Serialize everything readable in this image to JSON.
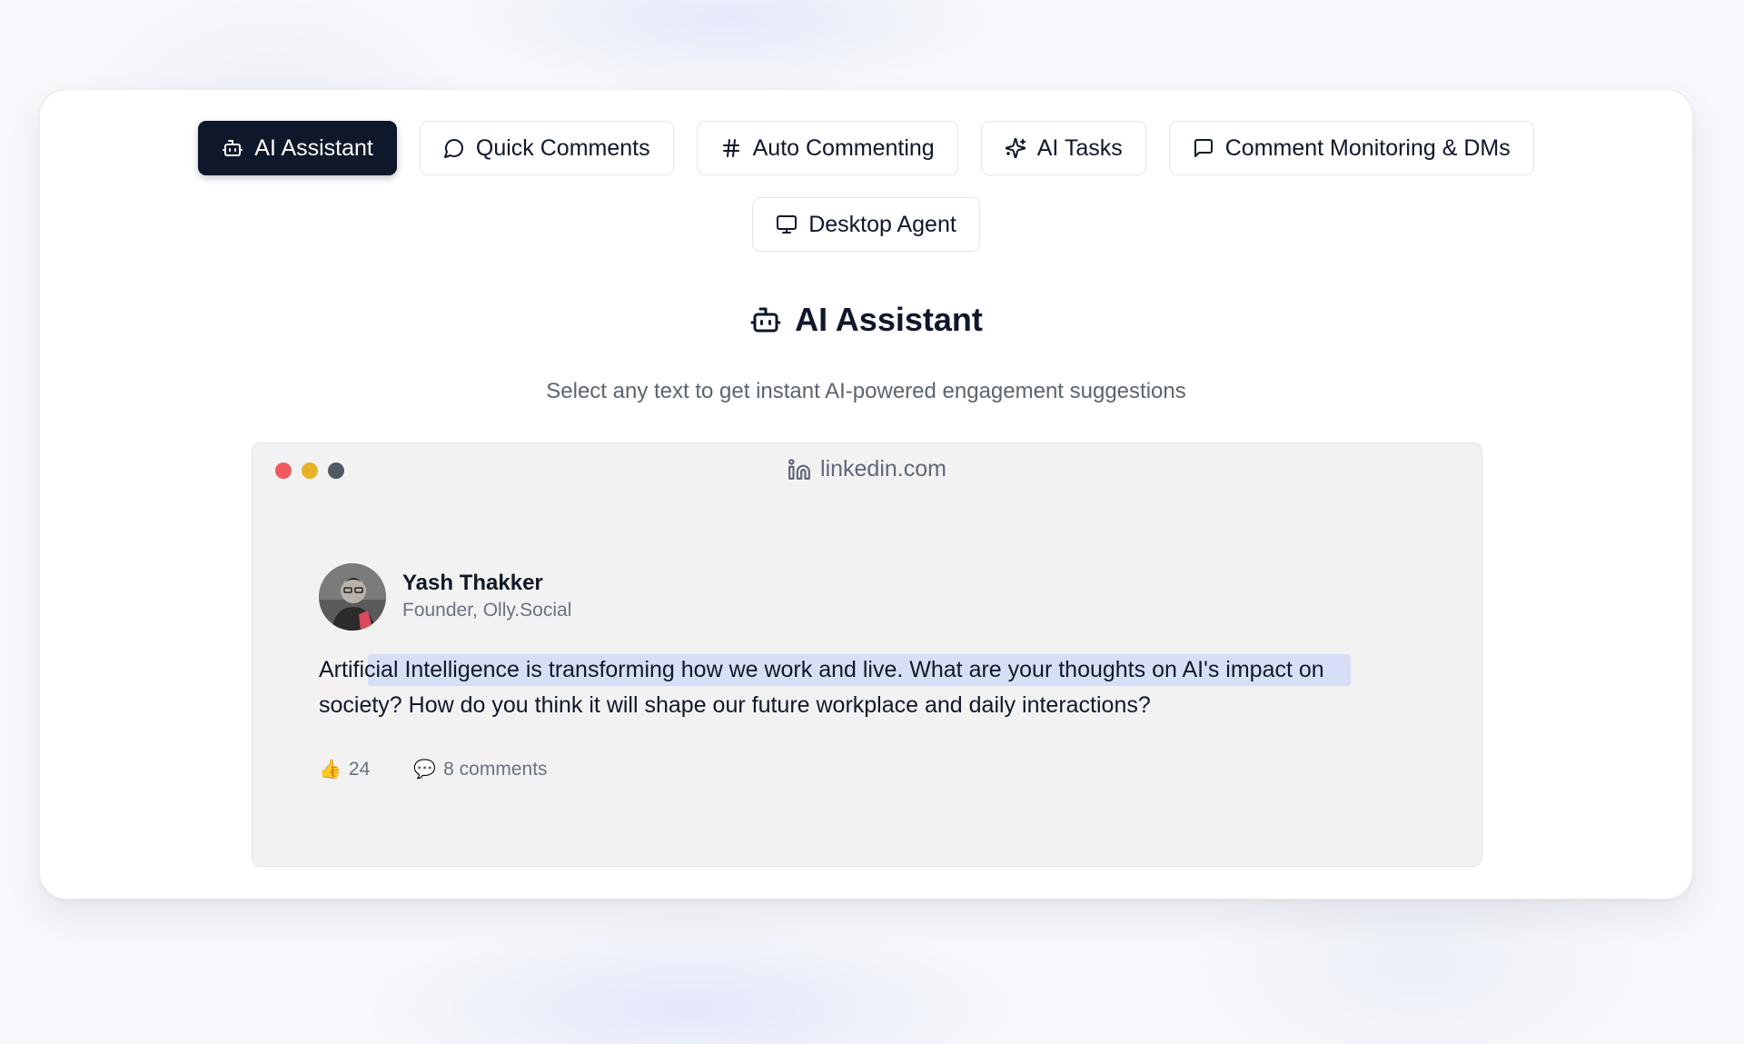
{
  "tabs": [
    {
      "label": "AI Assistant",
      "icon": "bot-icon",
      "active": true
    },
    {
      "label": "Quick Comments",
      "icon": "message-circle-icon",
      "active": false
    },
    {
      "label": "Auto Commenting",
      "icon": "hash-icon",
      "active": false
    },
    {
      "label": "AI Tasks",
      "icon": "sparkles-icon",
      "active": false
    },
    {
      "label": "Comment Monitoring & DMs",
      "icon": "message-square-icon",
      "active": false
    },
    {
      "label": "Desktop Agent",
      "icon": "monitor-icon",
      "active": false
    }
  ],
  "section": {
    "title": "AI Assistant",
    "subtitle": "Select any text to get instant AI-powered engagement suggestions"
  },
  "browser": {
    "url": "linkedin.com"
  },
  "post": {
    "author_name": "Yash Thakker",
    "author_title": "Founder, Olly.Social",
    "text": "Artificial Intelligence is transforming how we work and live. What are your thoughts on AI's impact on society? How do you think it will shape our future workplace and daily interactions?",
    "likes": "24",
    "comments": "8 comments"
  },
  "colors": {
    "active_tab": "#0f172a",
    "highlight": "#bfcff7",
    "dot_red": "#ef5a5f",
    "dot_yellow": "#e6b325",
    "dot_gray": "#4f5b64"
  }
}
